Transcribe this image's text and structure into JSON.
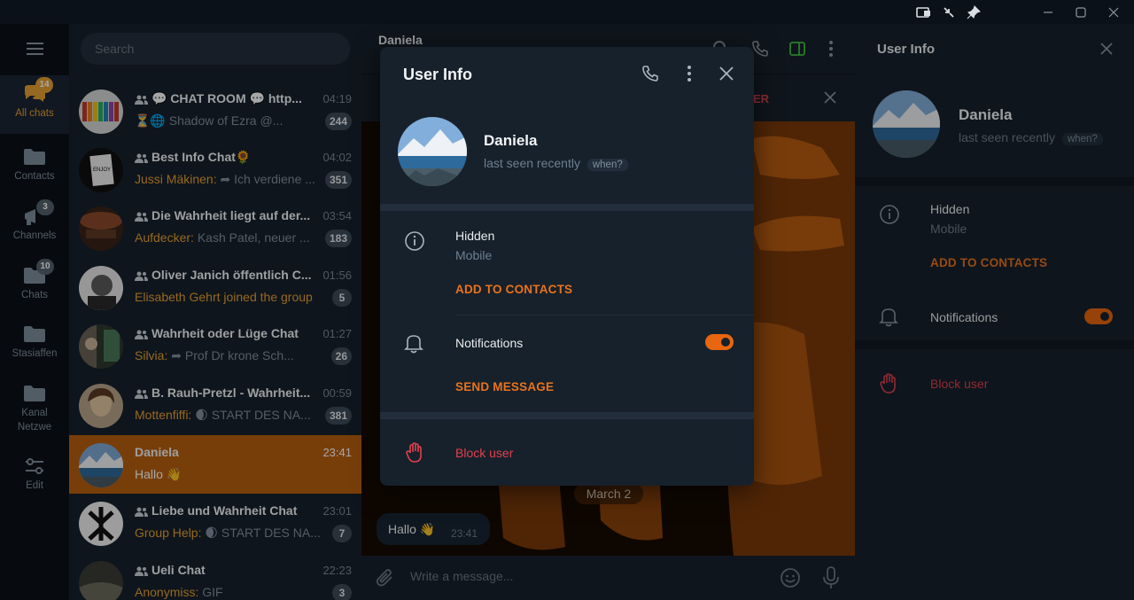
{
  "window": {
    "title": ""
  },
  "sidebar": {
    "folders": [
      {
        "label": "All chats",
        "badge": "14",
        "icon": "chat-bubbles-icon"
      },
      {
        "label": "Contacts",
        "badge": "",
        "icon": "folder-icon"
      },
      {
        "label": "Channels",
        "badge": "3",
        "icon": "channel-icon"
      },
      {
        "label": "Chats",
        "badge": "10",
        "icon": "folder-icon"
      },
      {
        "label": "Stasiaffen",
        "badge": "",
        "icon": "folder-icon"
      },
      {
        "label": "Kanal Netzwe",
        "badge": "",
        "icon": "folder-icon"
      },
      {
        "label": "Edit",
        "badge": "",
        "icon": "edit-filters-icon"
      }
    ]
  },
  "search": {
    "placeholder": "Search"
  },
  "chats": [
    {
      "name": "💬 CHAT ROOM 💬 http...",
      "time": "04:19",
      "sender": "",
      "message": "⏳🌐 Shadow of Ezra @...",
      "count": "244",
      "group": true
    },
    {
      "name": "Best Info Chat🌻",
      "time": "04:02",
      "sender": "Jussi Mäkinen:",
      "message": "Ich verdiene ...",
      "count": "351",
      "group": true
    },
    {
      "name": "Die Wahrheit liegt auf der...",
      "time": "03:54",
      "sender": "Aufdecker:",
      "message": "Kash Patel, neuer ...",
      "count": "183",
      "group": true
    },
    {
      "name": "Oliver Janich öffentlich C...",
      "time": "01:56",
      "sender": "Elisabeth Gehrt joined the group",
      "message": "",
      "count": "5",
      "group": true
    },
    {
      "name": "Wahrheit oder Lüge Chat",
      "time": "01:27",
      "sender": "Silvia:",
      "message": "Prof Dr krone Sch...",
      "count": "26",
      "group": true
    },
    {
      "name": "B. Rauh-Pretzl - Wahrheit...",
      "time": "00:59",
      "sender": "Mottenfiffi:",
      "message": "🌒 START DES NA...",
      "count": "381",
      "group": true
    },
    {
      "name": "Daniela",
      "time": "23:41",
      "sender": "",
      "message": "Hallo 👋",
      "count": "",
      "group": false
    },
    {
      "name": "Liebe und Wahrheit Chat",
      "time": "23:01",
      "sender": "Group Help:",
      "message": "🌒 START DES NA...",
      "count": "7",
      "group": true
    },
    {
      "name": "Ueli Chat",
      "time": "22:23",
      "sender": "Anonymiss:",
      "message": "GIF",
      "count": "3",
      "group": true
    }
  ],
  "conversation": {
    "title": "Daniela",
    "pinned_fragment": "ER",
    "date_label": "March 2",
    "message": {
      "text": "Hallo 👋",
      "time": "23:41"
    },
    "composer_placeholder": "Write a message..."
  },
  "modal": {
    "title": "User Info",
    "name": "Daniela",
    "status": "last seen recently",
    "when": "when?",
    "phone_label": "Hidden",
    "phone_sub": "Mobile",
    "add_contacts": "ADD TO CONTACTS",
    "notifications": "Notifications",
    "notifications_on": true,
    "send_message": "SEND MESSAGE",
    "block": "Block user"
  },
  "right_panel": {
    "title": "User Info",
    "name": "Daniela",
    "status": "last seen recently",
    "when": "when?",
    "phone_label": "Hidden",
    "phone_sub": "Mobile",
    "add_contacts": "ADD TO CONTACTS",
    "notifications": "Notifications",
    "notifications_on": true,
    "block": "Block user"
  },
  "colors": {
    "accent": "#e8731c",
    "active_chat": "#b86010",
    "danger": "#e0404e",
    "folder_active": "#e7a133"
  }
}
